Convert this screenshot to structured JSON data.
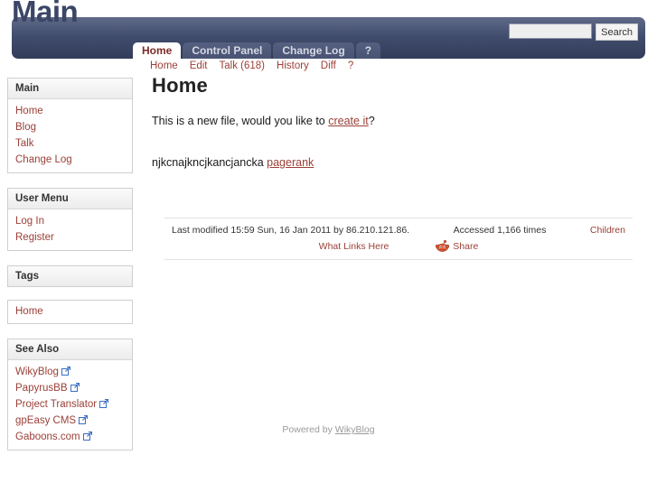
{
  "site": {
    "title": "Main"
  },
  "search": {
    "value": "",
    "placeholder": "",
    "button_label": "Search"
  },
  "tabs": [
    {
      "label": "Home",
      "active": true
    },
    {
      "label": "Control Panel",
      "active": false
    },
    {
      "label": "Change Log",
      "active": false
    },
    {
      "label": "?",
      "active": false
    }
  ],
  "subnav": [
    {
      "label": "Home"
    },
    {
      "label": "Edit"
    },
    {
      "label": "Talk (618)"
    },
    {
      "label": "History"
    },
    {
      "label": "Diff"
    },
    {
      "label": "?"
    }
  ],
  "sidebar": {
    "panels": [
      {
        "heading": "Main",
        "items": [
          {
            "label": "Home",
            "external": false
          },
          {
            "label": "Blog",
            "external": false
          },
          {
            "label": "Talk",
            "external": false
          },
          {
            "label": "Change Log",
            "external": false
          }
        ]
      },
      {
        "heading": "User Menu",
        "items": [
          {
            "label": "Log In",
            "external": false
          },
          {
            "label": "Register",
            "external": false
          }
        ]
      },
      {
        "heading": "Tags",
        "items": []
      },
      {
        "heading": "",
        "items": [
          {
            "label": "Home",
            "external": false
          }
        ]
      },
      {
        "heading": "See Also",
        "items": [
          {
            "label": "WikyBlog",
            "external": true
          },
          {
            "label": "PapyrusBB",
            "external": true
          },
          {
            "label": "Project Translator",
            "external": true
          },
          {
            "label": "gpEasy CMS",
            "external": true
          },
          {
            "label": "Gaboons.com",
            "external": true
          }
        ]
      }
    ]
  },
  "main": {
    "page_title": "Home",
    "paragraph1_before": "This is a new file, would you like to ",
    "paragraph1_link": "create it",
    "paragraph1_after": "?",
    "paragraph2_text": "njkcnajkncjkancjancka ",
    "paragraph2_link": "pagerank"
  },
  "infobar": {
    "last_modified": "Last modified 15:59 Sun, 16 Jan 2011 by 86.210.121.86.",
    "accessed": "Accessed 1,166 times",
    "children_link": "Children",
    "what_links_here": "What Links Here",
    "share_label": "Share",
    "share_icon": "reddit-icon"
  },
  "footer": {
    "powered_by_text": "Powered by ",
    "powered_by_link": "WikyBlog"
  },
  "colors": {
    "navy": "#3a4564",
    "link_red": "#9b4038",
    "active_tab_text": "#7d2b27",
    "panel_border": "#cfcfcf",
    "external_icon": "#3b6fc4",
    "reddit_orange": "#e8603c",
    "footer_gray": "#9a9a9a"
  }
}
